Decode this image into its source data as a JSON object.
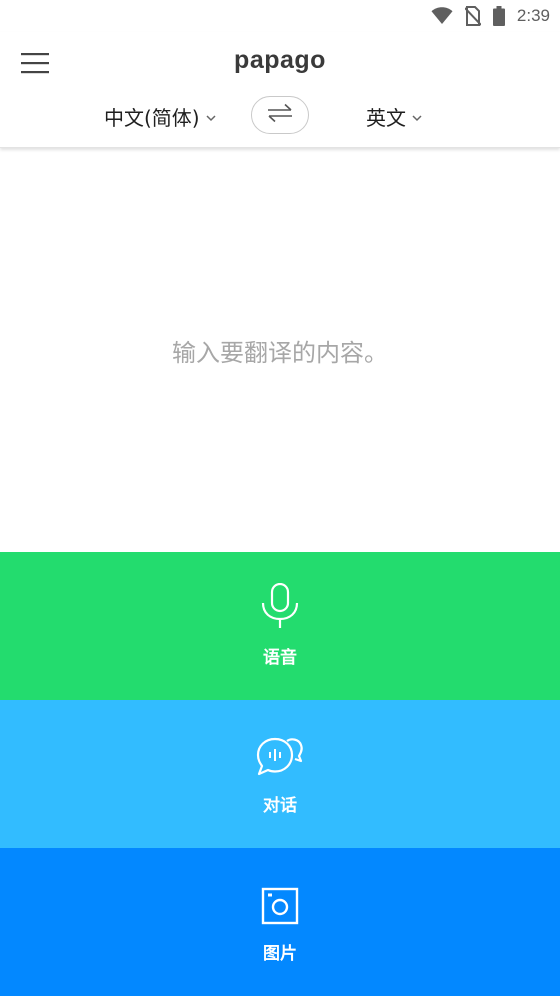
{
  "status_bar": {
    "time": "2:39",
    "icons": [
      "wifi-icon",
      "no-sim-icon",
      "battery-icon"
    ]
  },
  "header": {
    "logo": "papago",
    "source_lang": "中文(简体)",
    "target_lang": "英文",
    "icons": [
      "menu-icon",
      "swap-icon",
      "chevron-down-icon"
    ]
  },
  "input": {
    "placeholder": "输入要翻译的内容。"
  },
  "modes": [
    {
      "label": "语音",
      "icon": "microphone-icon",
      "color": "#23dc6e"
    },
    {
      "label": "对话",
      "icon": "conversation-icon",
      "color": "#32bcff"
    },
    {
      "label": "图片",
      "icon": "camera-icon",
      "color": "#0388ff"
    }
  ]
}
